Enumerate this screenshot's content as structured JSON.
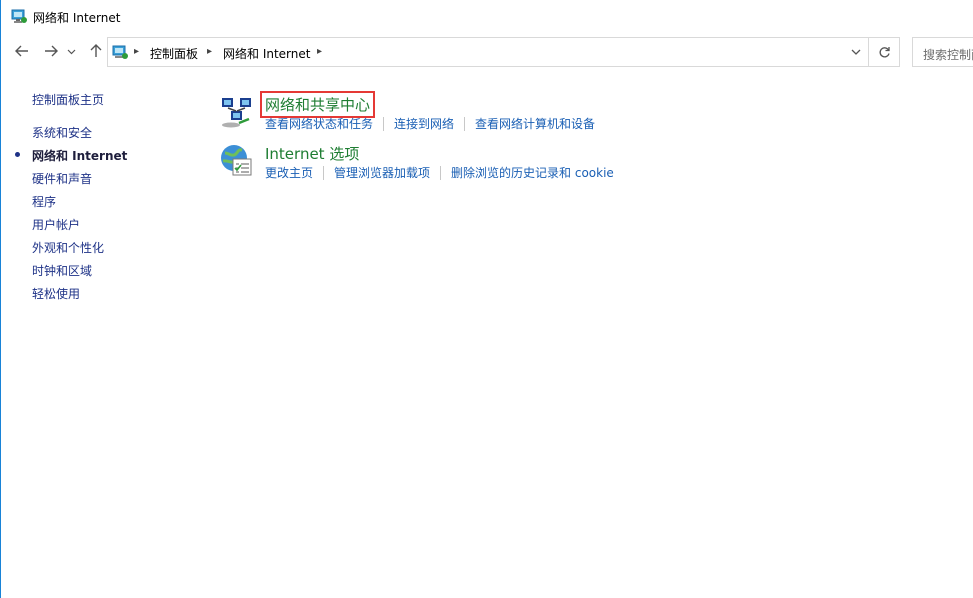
{
  "window": {
    "title": "网络和 Internet"
  },
  "nav": {
    "back_icon": "arrow-left-icon",
    "forward_icon": "arrow-right-icon",
    "recent_icon": "chevron-down-icon",
    "up_icon": "arrow-up-icon"
  },
  "address": {
    "breadcrumbs": [
      "控制面板",
      "网络和 Internet"
    ],
    "refresh_icon": "refresh-icon"
  },
  "search": {
    "placeholder": "搜索控制面"
  },
  "sidebar": {
    "home": "控制面板主页",
    "items": [
      {
        "label": "系统和安全",
        "current": false
      },
      {
        "label": "网络和 Internet",
        "current": true
      },
      {
        "label": "硬件和声音",
        "current": false
      },
      {
        "label": "程序",
        "current": false
      },
      {
        "label": "用户帐户",
        "current": false
      },
      {
        "label": "外观和个性化",
        "current": false
      },
      {
        "label": "时钟和区域",
        "current": false
      },
      {
        "label": "轻松使用",
        "current": false
      }
    ]
  },
  "categories": [
    {
      "title": "网络和共享中心",
      "icon": "network-sharing-icon",
      "links": [
        "查看网络状态和任务",
        "连接到网络",
        "查看网络计算机和设备"
      ]
    },
    {
      "title": "Internet 选项",
      "icon": "internet-options-icon",
      "links": [
        "更改主页",
        "管理浏览器加载项",
        "删除浏览的历史记录和 cookie"
      ]
    }
  ],
  "colors": {
    "link": "#1a5fb4",
    "category_title": "#1e7d32",
    "highlight_border": "#e53935",
    "window_border": "#1883d7"
  }
}
